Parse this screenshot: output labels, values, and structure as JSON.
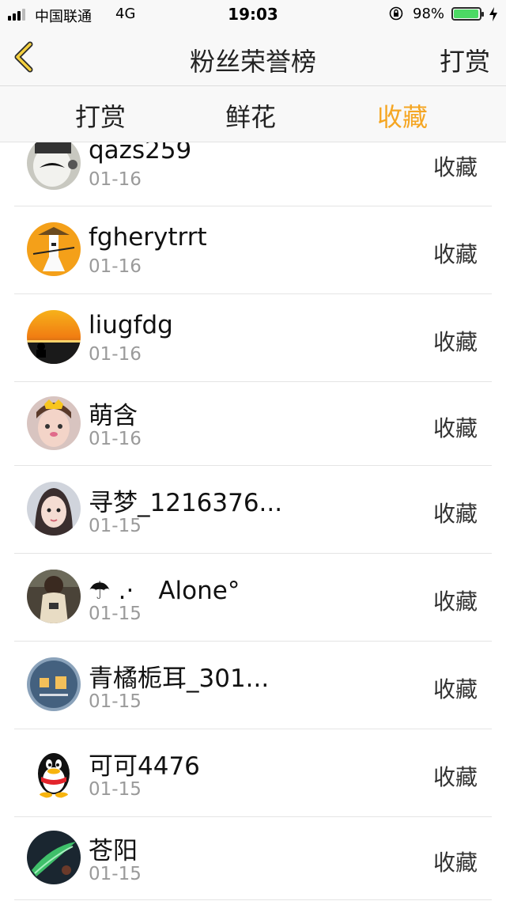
{
  "status_bar": {
    "carrier": "中国联通",
    "network": "4G",
    "time": "19:03",
    "battery": "98%",
    "battery_level": 0.98
  },
  "nav": {
    "title": "粉丝荣誉榜",
    "right_label": "打赏",
    "back_icon": "chevron-left-icon"
  },
  "tabs": [
    {
      "label": "打赏",
      "active": false
    },
    {
      "label": "鲜花",
      "active": false
    },
    {
      "label": "收藏",
      "active": true
    }
  ],
  "colors": {
    "accent": "#f5a623",
    "bar_bg": "#f8f8f8",
    "divider": "#e4e4e4",
    "date_text": "#9a9a9a"
  },
  "fans": [
    {
      "name": "qazs259",
      "date": "01-16",
      "action": "收藏",
      "avatar": "cartoon-face-avatar"
    },
    {
      "name": "fgherytrrt",
      "date": "01-16",
      "action": "收藏",
      "avatar": "swordsman-avatar"
    },
    {
      "name": "liugfdg",
      "date": "01-16",
      "action": "收藏",
      "avatar": "sunset-avatar"
    },
    {
      "name": "萌含",
      "date": "01-16",
      "action": "收藏",
      "avatar": "girl-crown-avatar"
    },
    {
      "name": "寻梦_1216376...",
      "date": "01-15",
      "action": "收藏",
      "avatar": "girl-portrait-avatar"
    },
    {
      "name": "☂ .·　Alone°",
      "date": "01-15",
      "action": "收藏",
      "avatar": "girl-back-avatar"
    },
    {
      "name": "青橘栀耳_301...",
      "date": "01-15",
      "action": "收藏",
      "avatar": "badge-avatar"
    },
    {
      "name": "可可4476",
      "date": "01-15",
      "action": "收藏",
      "avatar": "qq-penguin-avatar"
    },
    {
      "name": "苍阳",
      "date": "01-15",
      "action": "收藏",
      "avatar": "green-feather-avatar"
    }
  ]
}
